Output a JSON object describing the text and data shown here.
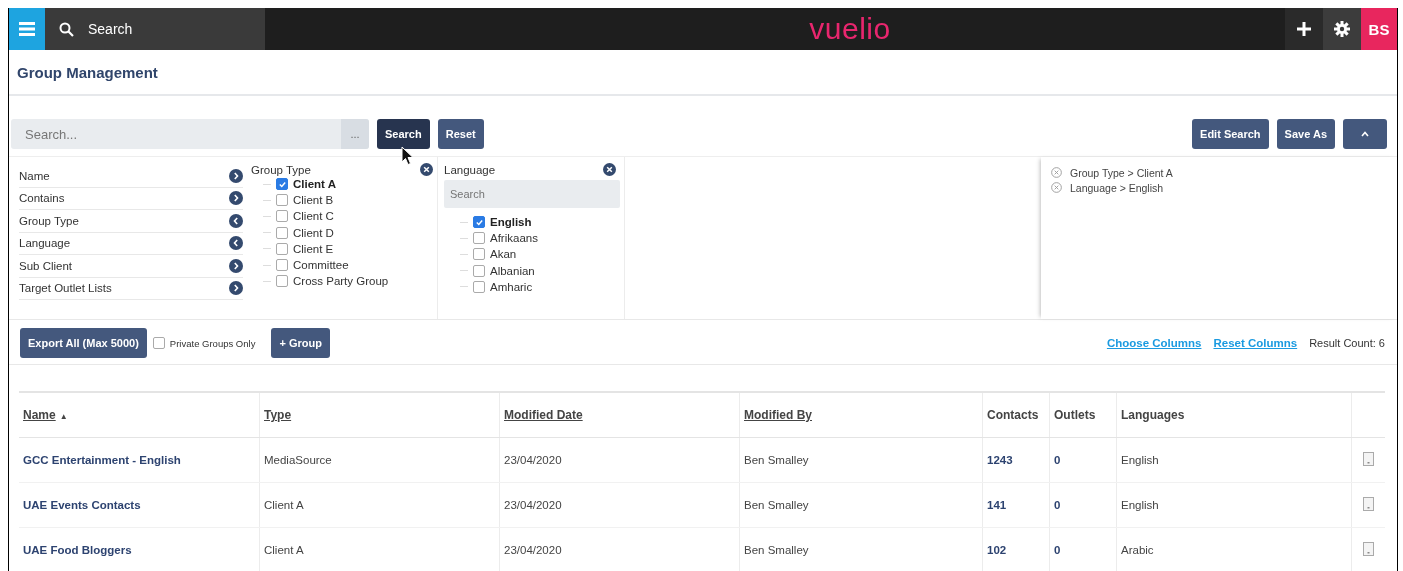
{
  "topbar": {
    "search_label": "Search",
    "logo": "vuelio",
    "user_initials": "BS"
  },
  "page_title": "Group Management",
  "search": {
    "placeholder": "Search...",
    "more": "...",
    "buttons": [
      {
        "label": "Search",
        "hovered": true
      },
      {
        "label": "Reset",
        "hovered": false
      }
    ]
  },
  "right_buttons": [
    "Edit Search",
    "Save As"
  ],
  "filter_fields": [
    {
      "label": "Name",
      "expanded": false
    },
    {
      "label": "Contains",
      "expanded": false
    },
    {
      "label": "Group Type",
      "expanded": true
    },
    {
      "label": "Language",
      "expanded": true
    },
    {
      "label": "Sub Client",
      "expanded": false
    },
    {
      "label": "Target Outlet Lists",
      "expanded": false
    }
  ],
  "group_type": {
    "title": "Group Type",
    "options": [
      {
        "label": "Client A",
        "checked": true
      },
      {
        "label": "Client B",
        "checked": false
      },
      {
        "label": "Client C",
        "checked": false
      },
      {
        "label": "Client D",
        "checked": false
      },
      {
        "label": "Client E",
        "checked": false
      },
      {
        "label": "Committee",
        "checked": false
      },
      {
        "label": "Cross Party Group",
        "checked": false
      }
    ]
  },
  "language": {
    "title": "Language",
    "search_placeholder": "Search",
    "options": [
      {
        "label": "English",
        "checked": true
      },
      {
        "label": "Afrikaans",
        "checked": false
      },
      {
        "label": "Akan",
        "checked": false
      },
      {
        "label": "Albanian",
        "checked": false
      },
      {
        "label": "Amharic",
        "checked": false
      }
    ]
  },
  "applied_filters": [
    "Group Type > Client A",
    "Language > English"
  ],
  "actions": {
    "export": "Export All (Max 5000)",
    "private_only": {
      "label": "Private Groups Only",
      "checked": false
    },
    "add_group": "+ Group"
  },
  "links": [
    "Choose Columns",
    "Reset Columns"
  ],
  "result_count": "Result Count: 6",
  "table": {
    "columns": [
      {
        "label": "Name",
        "sortable": true,
        "sort_indicator": "▲"
      },
      {
        "label": "Type",
        "sortable": true
      },
      {
        "label": "Modified Date",
        "sortable": true
      },
      {
        "label": "Modified By",
        "sortable": true
      },
      {
        "label": "Contacts",
        "sortable": false
      },
      {
        "label": "Outlets",
        "sortable": false
      },
      {
        "label": "Languages",
        "sortable": false
      }
    ],
    "rows": [
      {
        "name": "GCC Entertainment - English",
        "type": "MediaSource",
        "modified_date": "23/04/2020",
        "modified_by": "Ben Smalley",
        "contacts": "1243",
        "outlets": "0",
        "languages": "English"
      },
      {
        "name": "UAE Events Contacts",
        "type": "Client A",
        "modified_date": "23/04/2020",
        "modified_by": "Ben Smalley",
        "contacts": "141",
        "outlets": "0",
        "languages": "English"
      },
      {
        "name": "UAE Food Bloggers",
        "type": "Client A",
        "modified_date": "23/04/2020",
        "modified_by": "Ben Smalley",
        "contacts": "102",
        "outlets": "0",
        "languages": "Arabic"
      }
    ]
  }
}
